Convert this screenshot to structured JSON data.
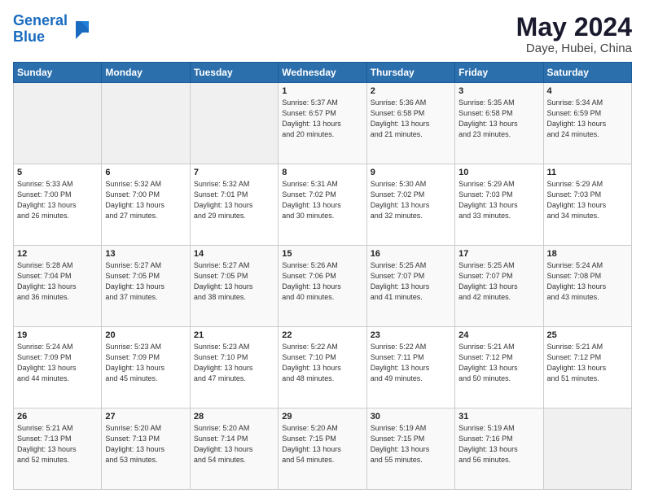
{
  "logo": {
    "line1": "General",
    "line2": "Blue"
  },
  "title": "May 2024",
  "location": "Daye, Hubei, China",
  "days_of_week": [
    "Sunday",
    "Monday",
    "Tuesday",
    "Wednesday",
    "Thursday",
    "Friday",
    "Saturday"
  ],
  "weeks": [
    [
      {
        "num": "",
        "info": ""
      },
      {
        "num": "",
        "info": ""
      },
      {
        "num": "",
        "info": ""
      },
      {
        "num": "1",
        "info": "Sunrise: 5:37 AM\nSunset: 6:57 PM\nDaylight: 13 hours\nand 20 minutes."
      },
      {
        "num": "2",
        "info": "Sunrise: 5:36 AM\nSunset: 6:58 PM\nDaylight: 13 hours\nand 21 minutes."
      },
      {
        "num": "3",
        "info": "Sunrise: 5:35 AM\nSunset: 6:58 PM\nDaylight: 13 hours\nand 23 minutes."
      },
      {
        "num": "4",
        "info": "Sunrise: 5:34 AM\nSunset: 6:59 PM\nDaylight: 13 hours\nand 24 minutes."
      }
    ],
    [
      {
        "num": "5",
        "info": "Sunrise: 5:33 AM\nSunset: 7:00 PM\nDaylight: 13 hours\nand 26 minutes."
      },
      {
        "num": "6",
        "info": "Sunrise: 5:32 AM\nSunset: 7:00 PM\nDaylight: 13 hours\nand 27 minutes."
      },
      {
        "num": "7",
        "info": "Sunrise: 5:32 AM\nSunset: 7:01 PM\nDaylight: 13 hours\nand 29 minutes."
      },
      {
        "num": "8",
        "info": "Sunrise: 5:31 AM\nSunset: 7:02 PM\nDaylight: 13 hours\nand 30 minutes."
      },
      {
        "num": "9",
        "info": "Sunrise: 5:30 AM\nSunset: 7:02 PM\nDaylight: 13 hours\nand 32 minutes."
      },
      {
        "num": "10",
        "info": "Sunrise: 5:29 AM\nSunset: 7:03 PM\nDaylight: 13 hours\nand 33 minutes."
      },
      {
        "num": "11",
        "info": "Sunrise: 5:29 AM\nSunset: 7:03 PM\nDaylight: 13 hours\nand 34 minutes."
      }
    ],
    [
      {
        "num": "12",
        "info": "Sunrise: 5:28 AM\nSunset: 7:04 PM\nDaylight: 13 hours\nand 36 minutes."
      },
      {
        "num": "13",
        "info": "Sunrise: 5:27 AM\nSunset: 7:05 PM\nDaylight: 13 hours\nand 37 minutes."
      },
      {
        "num": "14",
        "info": "Sunrise: 5:27 AM\nSunset: 7:05 PM\nDaylight: 13 hours\nand 38 minutes."
      },
      {
        "num": "15",
        "info": "Sunrise: 5:26 AM\nSunset: 7:06 PM\nDaylight: 13 hours\nand 40 minutes."
      },
      {
        "num": "16",
        "info": "Sunrise: 5:25 AM\nSunset: 7:07 PM\nDaylight: 13 hours\nand 41 minutes."
      },
      {
        "num": "17",
        "info": "Sunrise: 5:25 AM\nSunset: 7:07 PM\nDaylight: 13 hours\nand 42 minutes."
      },
      {
        "num": "18",
        "info": "Sunrise: 5:24 AM\nSunset: 7:08 PM\nDaylight: 13 hours\nand 43 minutes."
      }
    ],
    [
      {
        "num": "19",
        "info": "Sunrise: 5:24 AM\nSunset: 7:09 PM\nDaylight: 13 hours\nand 44 minutes."
      },
      {
        "num": "20",
        "info": "Sunrise: 5:23 AM\nSunset: 7:09 PM\nDaylight: 13 hours\nand 45 minutes."
      },
      {
        "num": "21",
        "info": "Sunrise: 5:23 AM\nSunset: 7:10 PM\nDaylight: 13 hours\nand 47 minutes."
      },
      {
        "num": "22",
        "info": "Sunrise: 5:22 AM\nSunset: 7:10 PM\nDaylight: 13 hours\nand 48 minutes."
      },
      {
        "num": "23",
        "info": "Sunrise: 5:22 AM\nSunset: 7:11 PM\nDaylight: 13 hours\nand 49 minutes."
      },
      {
        "num": "24",
        "info": "Sunrise: 5:21 AM\nSunset: 7:12 PM\nDaylight: 13 hours\nand 50 minutes."
      },
      {
        "num": "25",
        "info": "Sunrise: 5:21 AM\nSunset: 7:12 PM\nDaylight: 13 hours\nand 51 minutes."
      }
    ],
    [
      {
        "num": "26",
        "info": "Sunrise: 5:21 AM\nSunset: 7:13 PM\nDaylight: 13 hours\nand 52 minutes."
      },
      {
        "num": "27",
        "info": "Sunrise: 5:20 AM\nSunset: 7:13 PM\nDaylight: 13 hours\nand 53 minutes."
      },
      {
        "num": "28",
        "info": "Sunrise: 5:20 AM\nSunset: 7:14 PM\nDaylight: 13 hours\nand 54 minutes."
      },
      {
        "num": "29",
        "info": "Sunrise: 5:20 AM\nSunset: 7:15 PM\nDaylight: 13 hours\nand 54 minutes."
      },
      {
        "num": "30",
        "info": "Sunrise: 5:19 AM\nSunset: 7:15 PM\nDaylight: 13 hours\nand 55 minutes."
      },
      {
        "num": "31",
        "info": "Sunrise: 5:19 AM\nSunset: 7:16 PM\nDaylight: 13 hours\nand 56 minutes."
      },
      {
        "num": "",
        "info": ""
      }
    ]
  ]
}
